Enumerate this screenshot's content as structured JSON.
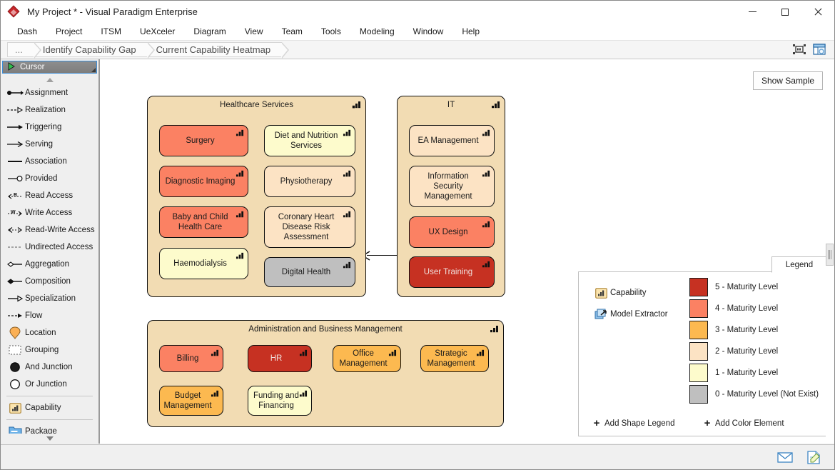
{
  "window": {
    "title": "My Project * - Visual Paradigm Enterprise",
    "app_icon": "visual-paradigm-diamond-icon",
    "minimize_label": "",
    "maximize_label": "",
    "close_label": ""
  },
  "menubar": {
    "items": [
      {
        "label": "Dash"
      },
      {
        "label": "Project"
      },
      {
        "label": "ITSM"
      },
      {
        "label": "UeXceler"
      },
      {
        "label": "Diagram"
      },
      {
        "label": "View"
      },
      {
        "label": "Team"
      },
      {
        "label": "Tools"
      },
      {
        "label": "Modeling"
      },
      {
        "label": "Window"
      },
      {
        "label": "Help"
      }
    ]
  },
  "breadcrumb": {
    "items": [
      {
        "label": "..."
      },
      {
        "label": "Identify Capability Gap"
      },
      {
        "label": "Current Capability Heatmap"
      }
    ],
    "right_icons": [
      {
        "name": "fit-to-screen-icon"
      },
      {
        "name": "open-specification-icon"
      }
    ]
  },
  "palette": {
    "selected": {
      "label": "Cursor",
      "icon": "cursor-arrow-icon"
    },
    "scroll_up": "scroll-up-arrow",
    "scroll_down": "scroll-down-arrow",
    "items": [
      {
        "label": "Assignment",
        "icon": "assignment-connector-icon"
      },
      {
        "label": "Realization",
        "icon": "realization-connector-icon"
      },
      {
        "label": "Triggering",
        "icon": "triggering-connector-icon"
      },
      {
        "label": "Serving",
        "icon": "serving-connector-icon"
      },
      {
        "label": "Association",
        "icon": "association-connector-icon"
      },
      {
        "label": "Provided",
        "icon": "provided-interface-icon"
      },
      {
        "label": "Read Access",
        "icon": "read-access-icon"
      },
      {
        "label": "Write Access",
        "icon": "write-access-icon"
      },
      {
        "label": "Read-Write Access",
        "icon": "read-write-access-icon"
      },
      {
        "label": "Undirected Access",
        "icon": "undirected-access-icon"
      },
      {
        "label": "Aggregation",
        "icon": "aggregation-connector-icon"
      },
      {
        "label": "Composition",
        "icon": "composition-connector-icon"
      },
      {
        "label": "Specialization",
        "icon": "specialization-connector-icon"
      },
      {
        "label": "Flow",
        "icon": "flow-connector-icon"
      },
      {
        "label": "Location",
        "icon": "location-pin-icon"
      },
      {
        "label": "Grouping",
        "icon": "grouping-icon"
      },
      {
        "label": "And Junction",
        "icon": "and-junction-icon"
      },
      {
        "label": "Or Junction",
        "icon": "or-junction-icon"
      },
      {
        "sep": true
      },
      {
        "label": "Capability",
        "icon": "capability-icon"
      },
      {
        "sep": true
      },
      {
        "label": "Package",
        "icon": "package-icon"
      }
    ]
  },
  "canvas": {
    "show_sample_label": "Show Sample",
    "groups": [
      {
        "title": "Healthcare Services",
        "icon": "capability-icon",
        "capabilities": [
          {
            "label": "Surgery",
            "level": 4
          },
          {
            "label": "Diet and Nutrition Services",
            "level": 1
          },
          {
            "label": "Diagnostic Imaging",
            "level": 4
          },
          {
            "label": "Physiotherapy",
            "level": 2
          },
          {
            "label": "Baby and Child Health Care",
            "level": 4
          },
          {
            "label": "Coronary Heart Disease Risk Assessment",
            "level": 2
          },
          {
            "label": "Haemodialysis",
            "level": 1
          },
          {
            "label": "Digital Health",
            "level": 0
          }
        ]
      },
      {
        "title": "IT",
        "icon": "capability-icon",
        "capabilities": [
          {
            "label": "EA Management",
            "level": 2
          },
          {
            "label": "Information Security Management",
            "level": 2
          },
          {
            "label": "UX Design",
            "level": 4
          },
          {
            "label": "User Training",
            "level": 5
          }
        ]
      },
      {
        "title": "Administration and Business Management",
        "icon": "capability-icon",
        "capabilities": [
          {
            "label": "Billing",
            "level": 4
          },
          {
            "label": "HR",
            "level": 5
          },
          {
            "label": "Office Management",
            "level": 3
          },
          {
            "label": "Strategic Management",
            "level": 3
          },
          {
            "label": "Budget Management",
            "level": 3
          },
          {
            "label": "Funding and Financing",
            "level": 1
          }
        ]
      }
    ]
  },
  "legend": {
    "tab_label": "Legend",
    "shape_items": [
      {
        "label": "Capability",
        "icon": "capability-icon"
      },
      {
        "label": "Model Extractor",
        "icon": "model-extractor-icon"
      }
    ],
    "color_items": [
      {
        "label": "5 - Maturity Level",
        "color": "#c63122"
      },
      {
        "label": "4 - Maturity Level",
        "color": "#fb8163"
      },
      {
        "label": "3 - Maturity Level",
        "color": "#fcb950"
      },
      {
        "label": "2 - Maturity Level",
        "color": "#fce3c4"
      },
      {
        "label": "1 - Maturity Level",
        "color": "#fdfbcc"
      },
      {
        "label": "0 - Maturity Level (Not Exist)",
        "color": "#bfbfbf"
      }
    ],
    "actions": [
      {
        "label": "Add Shape Legend",
        "icon": "plus-icon"
      },
      {
        "label": "Add Color Element",
        "icon": "plus-icon"
      }
    ]
  },
  "statusbar": {
    "icons": [
      {
        "name": "message-envelope-icon"
      },
      {
        "name": "note-document-icon"
      }
    ]
  },
  "colors": {
    "group_fill": "#f2dcb3",
    "level5": "#c63122",
    "level4": "#fb8163",
    "level3": "#fcb950",
    "level2": "#fce3c4",
    "level1": "#fdfbcc",
    "level0": "#bfbfbf",
    "accent": "#3e8fd8"
  }
}
